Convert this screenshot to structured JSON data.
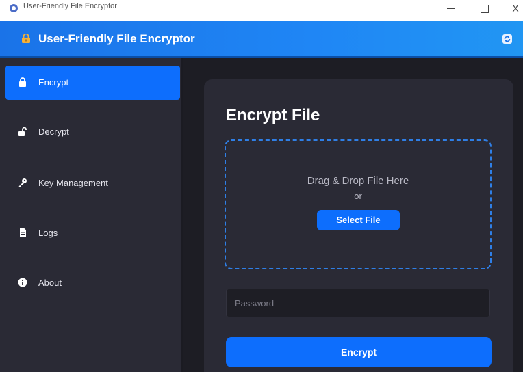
{
  "window": {
    "title": "User-Friendly File Encryptor",
    "controls": {
      "minimize": "—",
      "maximize": "☐",
      "close": "X"
    }
  },
  "header": {
    "title": "User-Friendly File Encryptor",
    "icon": "lock-icon",
    "action_icon": "refresh-icon",
    "color": "#1a73e8"
  },
  "sidebar": {
    "items": [
      {
        "label": "Encrypt",
        "icon": "lock-icon",
        "active": true
      },
      {
        "label": "Decrypt",
        "icon": "unlock-icon",
        "active": false
      },
      {
        "label": "Key Management",
        "icon": "key-icon",
        "active": false
      },
      {
        "label": "Logs",
        "icon": "document-icon",
        "active": false
      },
      {
        "label": "About",
        "icon": "info-icon",
        "active": false
      }
    ]
  },
  "main": {
    "title": "Encrypt File",
    "dropzone": {
      "text": "Drag & Drop File Here",
      "or": "or",
      "button": "Select File"
    },
    "password": {
      "placeholder": "Password",
      "value": ""
    },
    "submit_label": "Encrypt"
  },
  "colors": {
    "accent": "#0d6efd",
    "sidebar_bg": "#2a2a35",
    "main_bg": "#1d1d24",
    "card_bg": "#2a2a35"
  }
}
